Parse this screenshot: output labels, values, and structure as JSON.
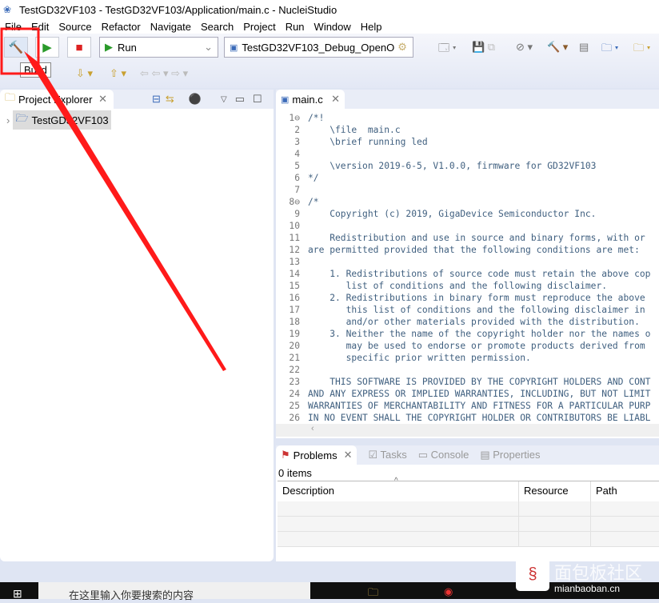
{
  "window": {
    "title": "TestGD32VF103 - TestGD32VF103/Application/main.c - NucleiStudio"
  },
  "menu": [
    "File",
    "Edit",
    "Source",
    "Refactor",
    "Navigate",
    "Search",
    "Project",
    "Run",
    "Window",
    "Help"
  ],
  "toolbar": {
    "build_tooltip": "Build",
    "launch_mode": "Run",
    "launch_config": "TestGD32VF103_Debug_OpenO"
  },
  "explorer": {
    "title": "Project Explorer",
    "project": "TestGD32VF103"
  },
  "editor": {
    "tab": "main.c",
    "lines": [
      "/*!",
      "    \\file  main.c",
      "    \\brief running led",
      "",
      "    \\version 2019-6-5, V1.0.0, firmware for GD32VF103",
      "*/",
      "",
      "/*",
      "    Copyright (c) 2019, GigaDevice Semiconductor Inc.",
      "",
      "    Redistribution and use in source and binary forms, with or",
      "are permitted provided that the following conditions are met:",
      "",
      "    1. Redistributions of source code must retain the above cop",
      "       list of conditions and the following disclaimer.",
      "    2. Redistributions in binary form must reproduce the above",
      "       this list of conditions and the following disclaimer in",
      "       and/or other materials provided with the distribution.",
      "    3. Neither the name of the copyright holder nor the names o",
      "       may be used to endorse or promote products derived from",
      "       specific prior written permission.",
      "",
      "    THIS SOFTWARE IS PROVIDED BY THE COPYRIGHT HOLDERS AND CONT",
      "AND ANY EXPRESS OR IMPLIED WARRANTIES, INCLUDING, BUT NOT LIMIT",
      "WARRANTIES OF MERCHANTABILITY AND FITNESS FOR A PARTICULAR PURP",
      "IN NO EVENT SHALL THE COPYRIGHT HOLDER OR CONTRIBUTORS BE LIABL"
    ]
  },
  "bottom": {
    "tabs": [
      "Problems",
      "Tasks",
      "Console",
      "Properties"
    ],
    "count": "0 items",
    "columns": [
      "Description",
      "Resource",
      "Path"
    ]
  },
  "taskbar": {
    "search_placeholder": "在这里输入你要搜索的内容"
  },
  "watermark": {
    "cn": "面包板社区",
    "url": "mianbaoban.cn"
  },
  "colors": {
    "highlight": "#ff0000",
    "comment": "#3f5f7f"
  }
}
